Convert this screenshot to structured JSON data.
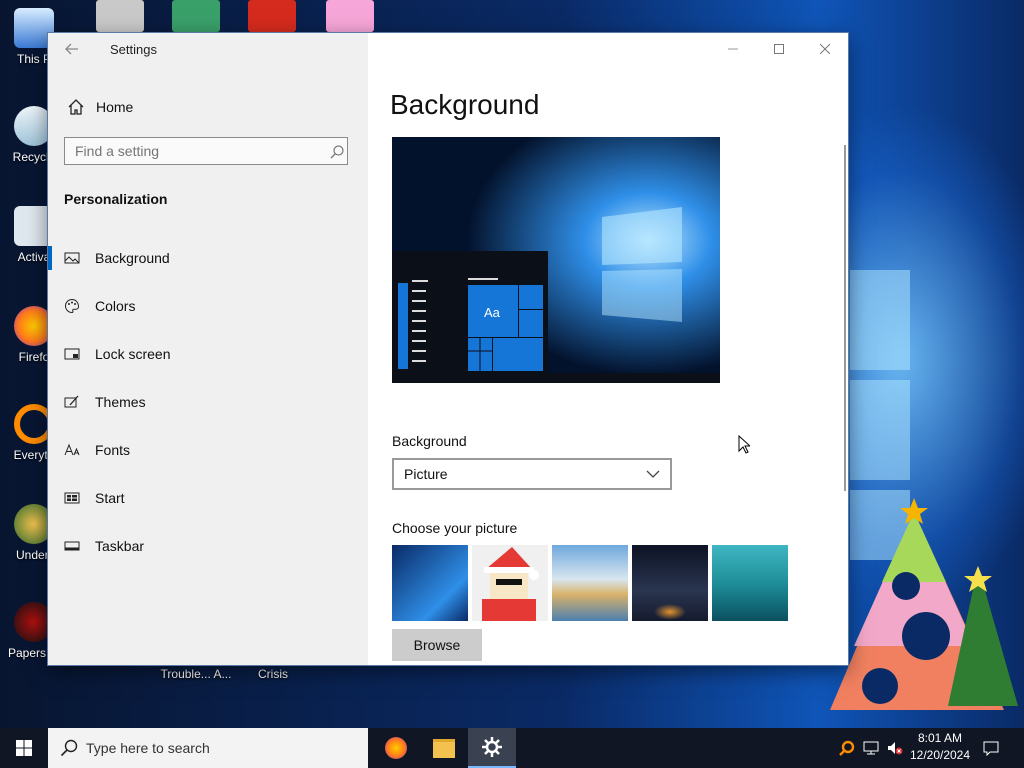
{
  "desktop": {
    "icons": [
      {
        "label": "This P",
        "color": "#3a7bd5"
      },
      {
        "label": "Recycle",
        "color": "#9fc4d8"
      },
      {
        "label": "Activa",
        "color": "#dfe7ef"
      },
      {
        "label": "Firefo",
        "color": "#ff7a1a"
      },
      {
        "label": "Everyth",
        "color": "#ff8c00"
      },
      {
        "label": "Undert",
        "color": "#2d6a2d"
      },
      {
        "label": "Papers, F",
        "color": "#b01010"
      }
    ],
    "bottom_labels": [
      "Trouble... A...",
      "Crisis"
    ]
  },
  "window": {
    "title": "Settings",
    "home_label": "Home",
    "search_placeholder": "Find a setting",
    "section_title": "Personalization",
    "nav": [
      {
        "label": "Background",
        "icon": "picture-icon",
        "selected": true
      },
      {
        "label": "Colors",
        "icon": "palette-icon",
        "selected": false
      },
      {
        "label": "Lock screen",
        "icon": "lock-screen-icon",
        "selected": false
      },
      {
        "label": "Themes",
        "icon": "themes-icon",
        "selected": false
      },
      {
        "label": "Fonts",
        "icon": "fonts-icon",
        "selected": false
      },
      {
        "label": "Start",
        "icon": "start-icon",
        "selected": false
      },
      {
        "label": "Taskbar",
        "icon": "taskbar-icon",
        "selected": false
      }
    ]
  },
  "content": {
    "page_title": "Background",
    "preview_sample_text": "Aa",
    "background_label": "Background",
    "background_value": "Picture",
    "choose_picture_label": "Choose your picture",
    "browse_label": "Browse",
    "thumbnails": [
      {
        "name": "windows-light",
        "colors": [
          "#0a2a66",
          "#2f8fe8"
        ]
      },
      {
        "name": "santa-cartoon",
        "colors": [
          "#ffffff",
          "#e53935"
        ]
      },
      {
        "name": "beach-rocks",
        "colors": [
          "#6fa8dc",
          "#d9b26a"
        ]
      },
      {
        "name": "night-sky-tent",
        "colors": [
          "#151b2e",
          "#e0922f"
        ]
      },
      {
        "name": "underwater-swimmer",
        "colors": [
          "#1e8f99",
          "#0b5060"
        ]
      }
    ]
  },
  "taskbar": {
    "search_placeholder": "Type here to search",
    "time": "8:01 AM",
    "date": "12/20/2024"
  },
  "colors": {
    "accent": "#0067c0",
    "sidebar_bg": "#f0f0f0"
  }
}
